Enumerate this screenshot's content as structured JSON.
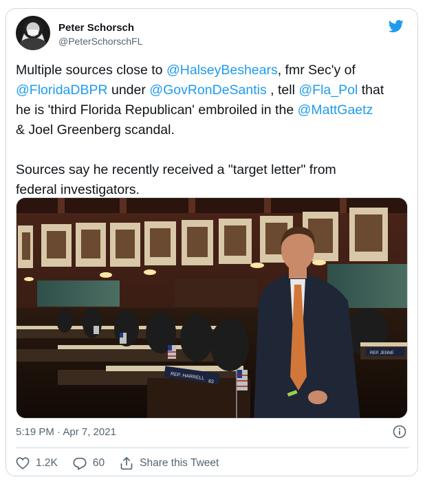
{
  "author": {
    "name": "Peter Schorsch",
    "handle": "@PeterSchorschFL",
    "avatar_icon": "masked-man-avatar"
  },
  "brand": {
    "icon": "twitter-bird-icon",
    "color": "#1d9bf0"
  },
  "tweet": {
    "segments": [
      {
        "text": "Multiple sources close to ",
        "mention": false
      },
      {
        "text": "@HalseyBeshears",
        "mention": true
      },
      {
        "text": ", fmr Sec'y of\n",
        "mention": false
      },
      {
        "text": "@FloridaDBPR",
        "mention": true
      },
      {
        "text": " under ",
        "mention": false
      },
      {
        "text": "@GovRonDeSantis",
        "mention": true
      },
      {
        "text": " , tell ",
        "mention": false
      },
      {
        "text": "@Fla_Pol",
        "mention": true
      },
      {
        "text": " that\nhe is 'third Florida Republican' embroiled in the ",
        "mention": false
      },
      {
        "text": "@MattGaetz",
        "mention": true
      },
      {
        "text": "\n& Joel Greenberg scandal.\n\nSources say he recently received a \"target letter\" from\nfederal investigators.",
        "mention": false
      }
    ]
  },
  "photo": {
    "alt_icon": "florida-house-chamber-photo",
    "nameplates": [
      "REP. HARRELL",
      "83",
      "REP. JENNE"
    ]
  },
  "meta": {
    "timestamp": "5:19 PM · Apr 7, 2021"
  },
  "actions": {
    "likes": "1.2K",
    "replies": "60",
    "share_label": "Share this Tweet"
  },
  "colors": {
    "text": "#0f1419",
    "secondary": "#536471",
    "mention": "#1d9bf0",
    "border": "#cfd9de"
  }
}
